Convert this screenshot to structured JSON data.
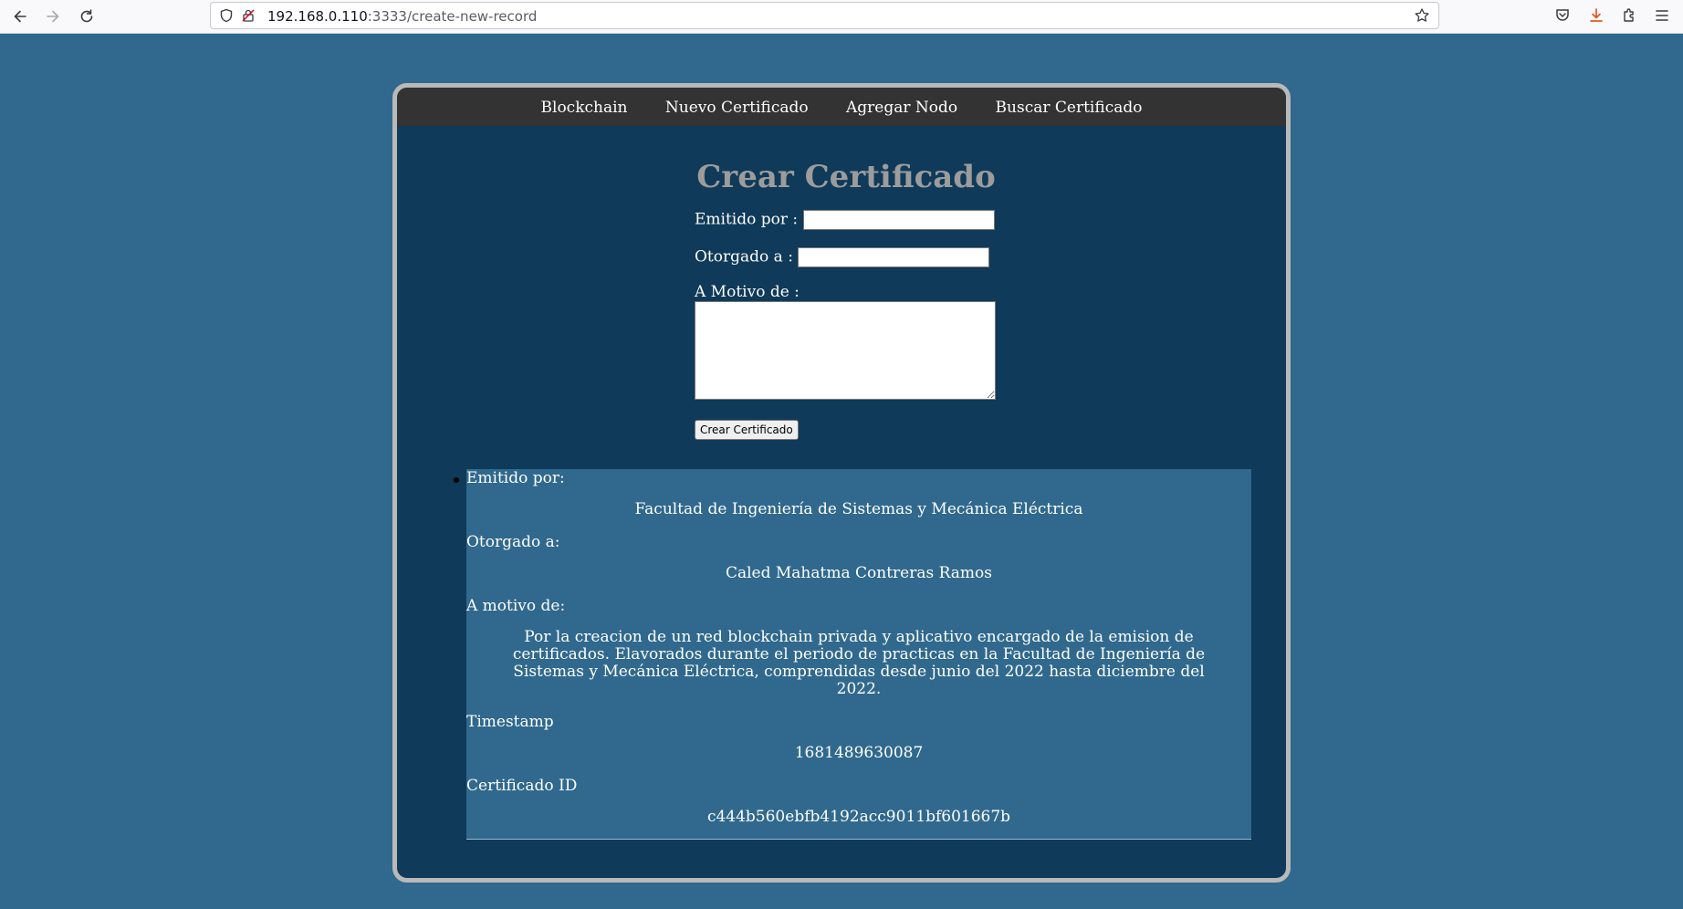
{
  "browser": {
    "url_host": "192.168.0.110",
    "url_path": ":3333/create-new-record",
    "back_icon": "arrow-left-icon",
    "forward_icon": "arrow-right-icon",
    "reload_icon": "reload-icon"
  },
  "nav": {
    "items": [
      {
        "label": "Blockchain"
      },
      {
        "label": "Nuevo Certificado"
      },
      {
        "label": "Agregar Nodo"
      },
      {
        "label": "Buscar Certificado"
      }
    ]
  },
  "form": {
    "title": "Crear Certificado",
    "emitido_label": "Emitido por :",
    "emitido_value": "",
    "otorgado_label": "Otorgado a :",
    "otorgado_value": "",
    "motivo_label": "A Motivo de :",
    "motivo_value": "",
    "submit_label": "Crear Certificado"
  },
  "records": [
    {
      "emitido_label": "Emitido por:",
      "emitido": "Facultad de Ingeniería de Sistemas y Mecánica Eléctrica",
      "otorgado_label": "Otorgado a:",
      "otorgado": "Caled Mahatma Contreras Ramos",
      "motivo_label": "A motivo de:",
      "motivo": "Por la creacion de un red blockchain privada y aplicativo encargado de la emision de certificados. Elavorados durante el periodo de practicas en la Facultad de Ingeniería de Sistemas y Mecánica Eléctrica, comprendidas desde junio del 2022 hasta diciembre del 2022.",
      "timestamp_label": "Timestamp",
      "timestamp": "1681489630087",
      "id_label": "Certificado ID",
      "id": "c444b560ebfb4192acc9011bf601667b"
    }
  ],
  "colors": {
    "page_bg": "#30698d",
    "card_bg": "#0f3a59",
    "nav_bg": "#333333",
    "title": "#9c9c9c"
  }
}
